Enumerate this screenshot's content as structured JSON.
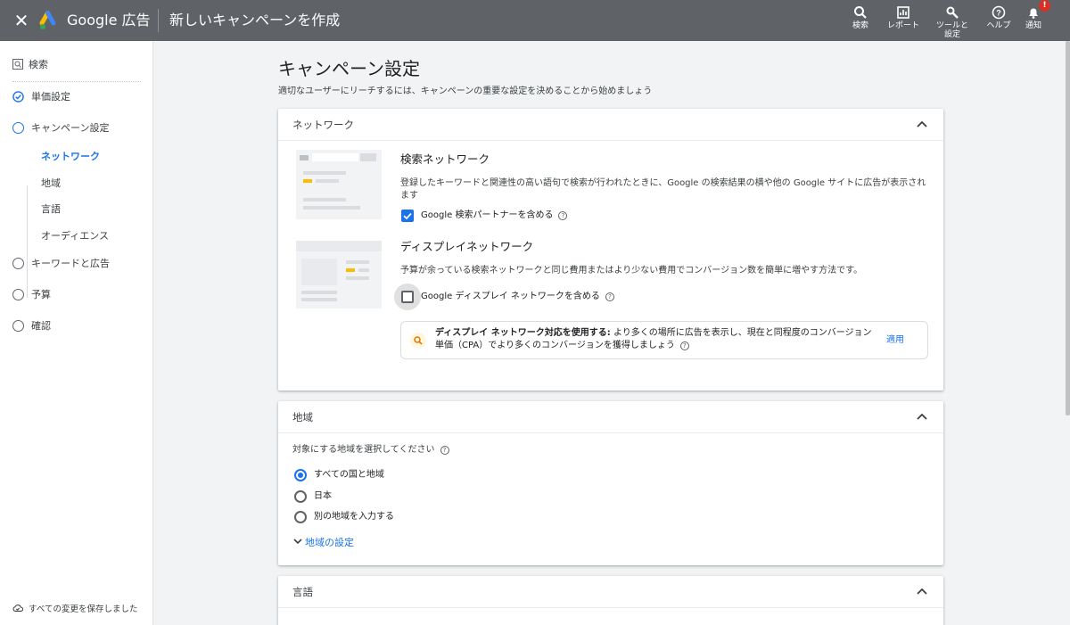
{
  "header": {
    "brand": "Google 広告",
    "title": "新しいキャンペーンを作成",
    "actions": [
      {
        "label": "検索",
        "icon": "search-icon"
      },
      {
        "label": "レポート",
        "icon": "reports-icon"
      },
      {
        "label": "ツールと\n設定",
        "icon": "wrench-icon"
      },
      {
        "label": "ヘルプ",
        "icon": "help-icon"
      },
      {
        "label": "通知",
        "icon": "bell-icon",
        "badge": "!"
      }
    ]
  },
  "sidebar": {
    "search_label": "検索",
    "steps": [
      {
        "label": "単価設定",
        "state": "done"
      },
      {
        "label": "キャンペーン設定",
        "state": "current"
      },
      {
        "label": "キーワードと広告",
        "state": "todo"
      },
      {
        "label": "予算",
        "state": "todo"
      },
      {
        "label": "確認",
        "state": "todo"
      }
    ],
    "substeps": [
      "ネットワーク",
      "地域",
      "言語",
      "オーディエンス"
    ],
    "save_status": "すべての変更を保存しました"
  },
  "main": {
    "title": "キャンペーン設定",
    "subtitle": "適切なユーザーにリーチするには、キャンペーンの重要な設定を決めることから始めましょう",
    "network_card": {
      "title": "ネットワーク",
      "search_title": "検索ネットワーク",
      "search_desc": "登録したキーワードと関連性の高い語句で検索が行われたときに、Google の検索結果の横や他の Google サイトに広告が表示されます",
      "search_partner_label": "Google 検索パートナーを含める",
      "search_partner_checked": true,
      "display_title": "ディスプレイネットワーク",
      "display_desc": "予算が余っている検索ネットワークと同じ費用またはより少ない費用でコンバージョン数を簡単に増やす方法です。",
      "display_label": "Google ディスプレイ ネットワークを含める",
      "display_checked": false,
      "reco_bold": "ディスプレイ ネットワーク対応を使用する:",
      "reco_text": " より多くの場所に広告を表示し、現在と同程度のコンバージョン単価（CPA）でより多くのコンバージョンを獲得しましょう",
      "reco_apply": "適用"
    },
    "location_card": {
      "title": "地域",
      "prompt": "対象にする地域を選択してください",
      "options": [
        "すべての国と地域",
        "日本",
        "別の地域を入力する"
      ],
      "selected": 0,
      "settings_link": "地域の設定"
    },
    "language_card": {
      "title": "言語"
    }
  },
  "colors": {
    "topbar": "#5f6368",
    "accent": "#1a73e8",
    "yellow": "#fbbc04",
    "badge": "#d93025"
  }
}
